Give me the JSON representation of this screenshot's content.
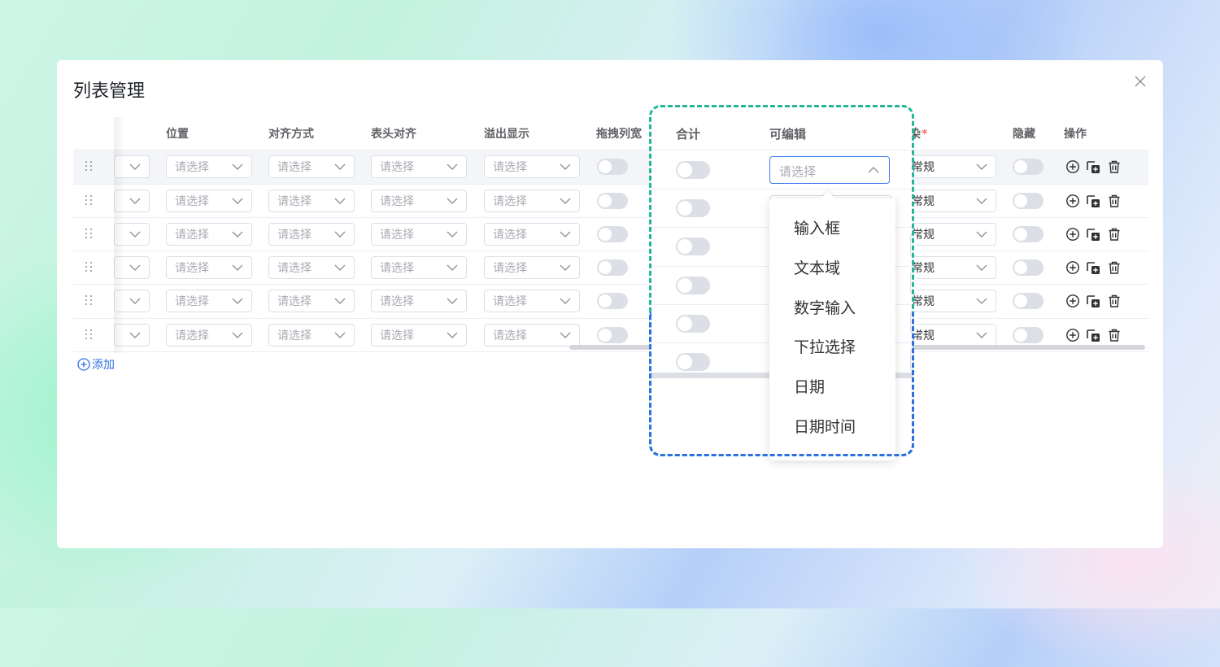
{
  "dialog": {
    "title": "列表管理"
  },
  "columns": {
    "position": "位置",
    "align": "对齐方式",
    "header_align": "表头对齐",
    "overflow": "溢出显示",
    "drag_width": "拖拽列宽",
    "sum": "合计",
    "editable": "可编辑",
    "render": "染",
    "hidden": "隐藏",
    "actions": "操作"
  },
  "placeholders": {
    "select": "请选择"
  },
  "render_value": "常规",
  "add_button": "添加",
  "editable_options": [
    "输入框",
    "文本域",
    "数字输入",
    "下拉选择",
    "日期",
    "日期时间"
  ],
  "colors": {
    "accent": "#3f7cf0",
    "frame_green": "#22b79a",
    "frame_blue": "#2f6fe4",
    "required": "#f56c6c"
  },
  "icons": [
    "grip-icon",
    "chevron-down-icon",
    "chevron-up-icon",
    "add-circle-icon",
    "copy-add-icon",
    "trash-icon",
    "close-icon"
  ]
}
